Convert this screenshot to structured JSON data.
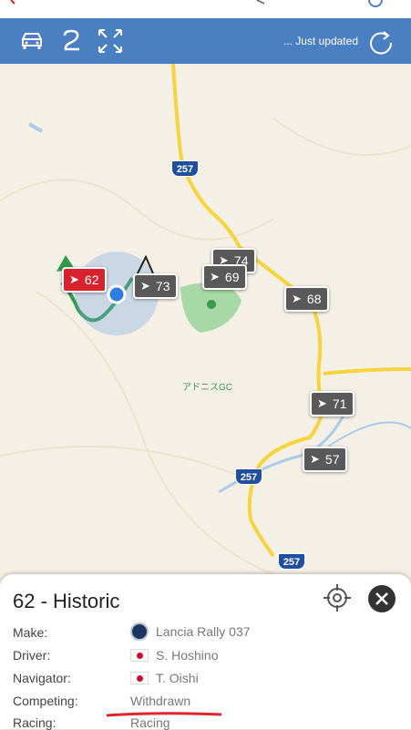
{
  "toolbar": {
    "status": "... Just updated",
    "icons": [
      "car-icon",
      "track-icon",
      "expand-icon",
      "refresh-icon"
    ]
  },
  "map": {
    "road_number": "257",
    "golf_course": "アドニスGC",
    "markers": [
      {
        "number": "62",
        "highlighted": true
      },
      {
        "number": "73"
      },
      {
        "number": "74"
      },
      {
        "number": "69"
      },
      {
        "number": "68"
      },
      {
        "number": "71"
      },
      {
        "number": "57"
      }
    ]
  },
  "panel": {
    "title": "62 - Historic",
    "rows": [
      {
        "label": "Make:",
        "value": "Lancia Rally 037"
      },
      {
        "label": "Driver:",
        "value": "S. Hoshino"
      },
      {
        "label": "Navigator:",
        "value": "T. Oishi"
      },
      {
        "label": "Competing:",
        "value": "Withdrawn"
      },
      {
        "label": "Racing:",
        "value": "Racing"
      }
    ]
  },
  "colors": {
    "toolbar": "#4a7fc1",
    "marker": "#595959",
    "marker_highlight": "#d8232f",
    "road": "#f7d33c",
    "underline": "#e0262b"
  }
}
